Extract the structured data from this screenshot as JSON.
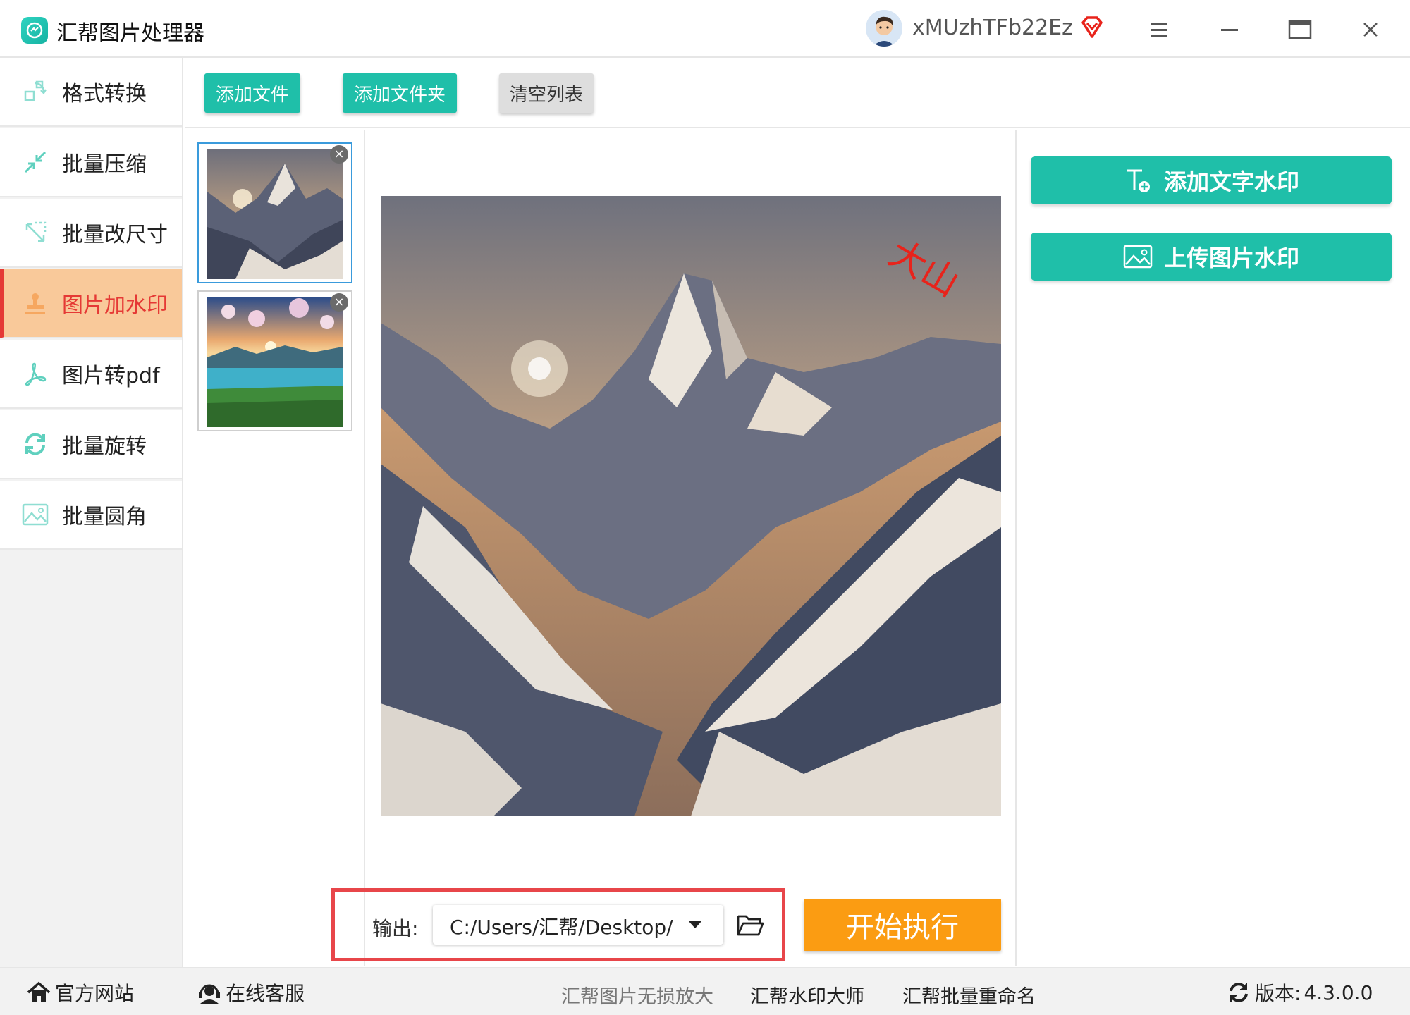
{
  "app": {
    "title": "汇帮图片处理器",
    "username": "xMUzhTFb22Ez"
  },
  "colors": {
    "accent": "#1fbfa9",
    "active_bg": "#f9c99a",
    "active_text": "#e53935",
    "start": "#fb9c12",
    "highlight": "#e8464a"
  },
  "window_controls": {
    "menu_icon": "hamburger-icon",
    "minimize_icon": "minimize-icon",
    "maximize_icon": "maximize-icon",
    "close_icon": "close-icon"
  },
  "sidebar": {
    "items": [
      {
        "label": "格式转换",
        "icon": "format-convert-icon",
        "active": false
      },
      {
        "label": "批量压缩",
        "icon": "compress-icon",
        "active": false
      },
      {
        "label": "批量改尺寸",
        "icon": "resize-icon",
        "active": false
      },
      {
        "label": "图片加水印",
        "icon": "stamp-icon",
        "active": true
      },
      {
        "label": "图片转pdf",
        "icon": "pdf-icon",
        "active": false
      },
      {
        "label": "批量旋转",
        "icon": "rotate-icon",
        "active": false
      },
      {
        "label": "批量圆角",
        "icon": "image-icon",
        "active": false
      }
    ]
  },
  "toolbar": {
    "add_file": "添加文件",
    "add_folder": "添加文件夹",
    "clear_list": "清空列表"
  },
  "thumbnails": [
    {
      "name": "mountain",
      "selected": true
    },
    {
      "name": "lake",
      "selected": false
    }
  ],
  "preview": {
    "watermark_text": "大山"
  },
  "watermark_panel": {
    "add_text": "添加文字水印",
    "upload_image": "上传图片水印"
  },
  "output": {
    "label": "输出:",
    "path": "C:/Users/汇帮/Desktop/",
    "start": "开始执行"
  },
  "statusbar": {
    "website": "官方网站",
    "support": "在线客服",
    "links": [
      "汇帮图片无损放大",
      "汇帮水印大师",
      "汇帮批量重命名"
    ],
    "version_label": "版本:",
    "version": "4.3.0.0"
  }
}
